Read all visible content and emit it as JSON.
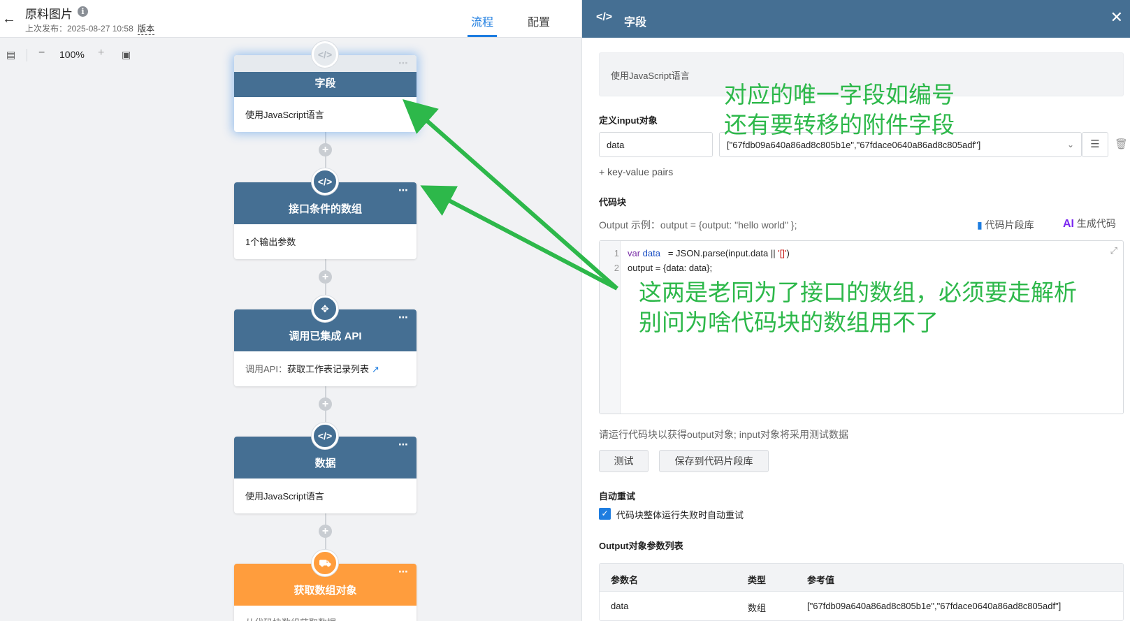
{
  "header": {
    "title": "原料图片",
    "last_published": "上次发布：2025-08-27 10:58",
    "version_link": "版本",
    "tabs": [
      {
        "label": "流程",
        "active": true
      },
      {
        "label": "配置",
        "active": false
      }
    ]
  },
  "toolbar": {
    "zoom_level": "100%"
  },
  "flow": {
    "nodes": [
      {
        "title": "字段",
        "body": "使用JavaScript语言",
        "icon": "code-icon"
      },
      {
        "title": "接口条件的数组",
        "body": "1个输出参数",
        "icon": "code-icon"
      },
      {
        "title": "调用已集成 API",
        "body_prefix": "调用API：",
        "body_link": "获取工作表记录列表",
        "icon": "api-icon"
      },
      {
        "title": "数据",
        "body": "使用JavaScript语言",
        "icon": "code-icon"
      },
      {
        "title": "获取数组对象",
        "body": "从代码块数组获取数据",
        "icon": "truck-icon",
        "accent": "#ff9d3d"
      }
    ]
  },
  "panel": {
    "title": "字段",
    "description": "使用JavaScript语言",
    "input_section_label": "定义input对象",
    "input_key": "data",
    "input_value": "[\"67fdb09a640a86ad8c805b1e\",\"67fdace0640a86ad8c805adf\"]",
    "add_pair_link": "+ key-value pairs",
    "code_section_label": "代码块",
    "output_hint": "Output 示例：output = {output: \"hello world\" };",
    "snippet_lib_link": "代码片段库",
    "ai_badge": "AI",
    "ai_generate_link": "生成代码",
    "code_lines": [
      {
        "num": "1",
        "kw": "var",
        "var": " data",
        "rest": "   = JSON.parse(input.data || ",
        "str": "'[]'",
        "end": ")"
      },
      {
        "num": "2",
        "text": "output = {data: data};"
      }
    ],
    "run_hint": "请运行代码块以获得output对象; input对象将采用测试数据",
    "test_button": "测试",
    "save_snippet_button": "保存到代码片段库",
    "retry_label": "自动重试",
    "retry_checkbox_label": "代码块整体运行失败时自动重试",
    "output_table_label": "Output对象参数列表",
    "output_table": {
      "headers": [
        "参数名",
        "类型",
        "参考值"
      ],
      "rows": [
        [
          "data",
          "数组",
          "[\"67fdb09a640a86ad8c805b1e\",\"67fdace0640a86ad8c805adf\"]"
        ]
      ]
    }
  },
  "annotations": {
    "note1_line1": "对应的唯一字段如编号",
    "note1_line2": "还有要转移的附件字段",
    "note2_line1": "这两是老同为了接口的数组，必须要走解析",
    "note2_line2": "别问为啥代码块的数组用不了",
    "color": "#2db84a"
  },
  "colors": {
    "node_header": "#456f93",
    "accent_blue": "#1e7de0",
    "node_orange": "#ff9d3d"
  }
}
